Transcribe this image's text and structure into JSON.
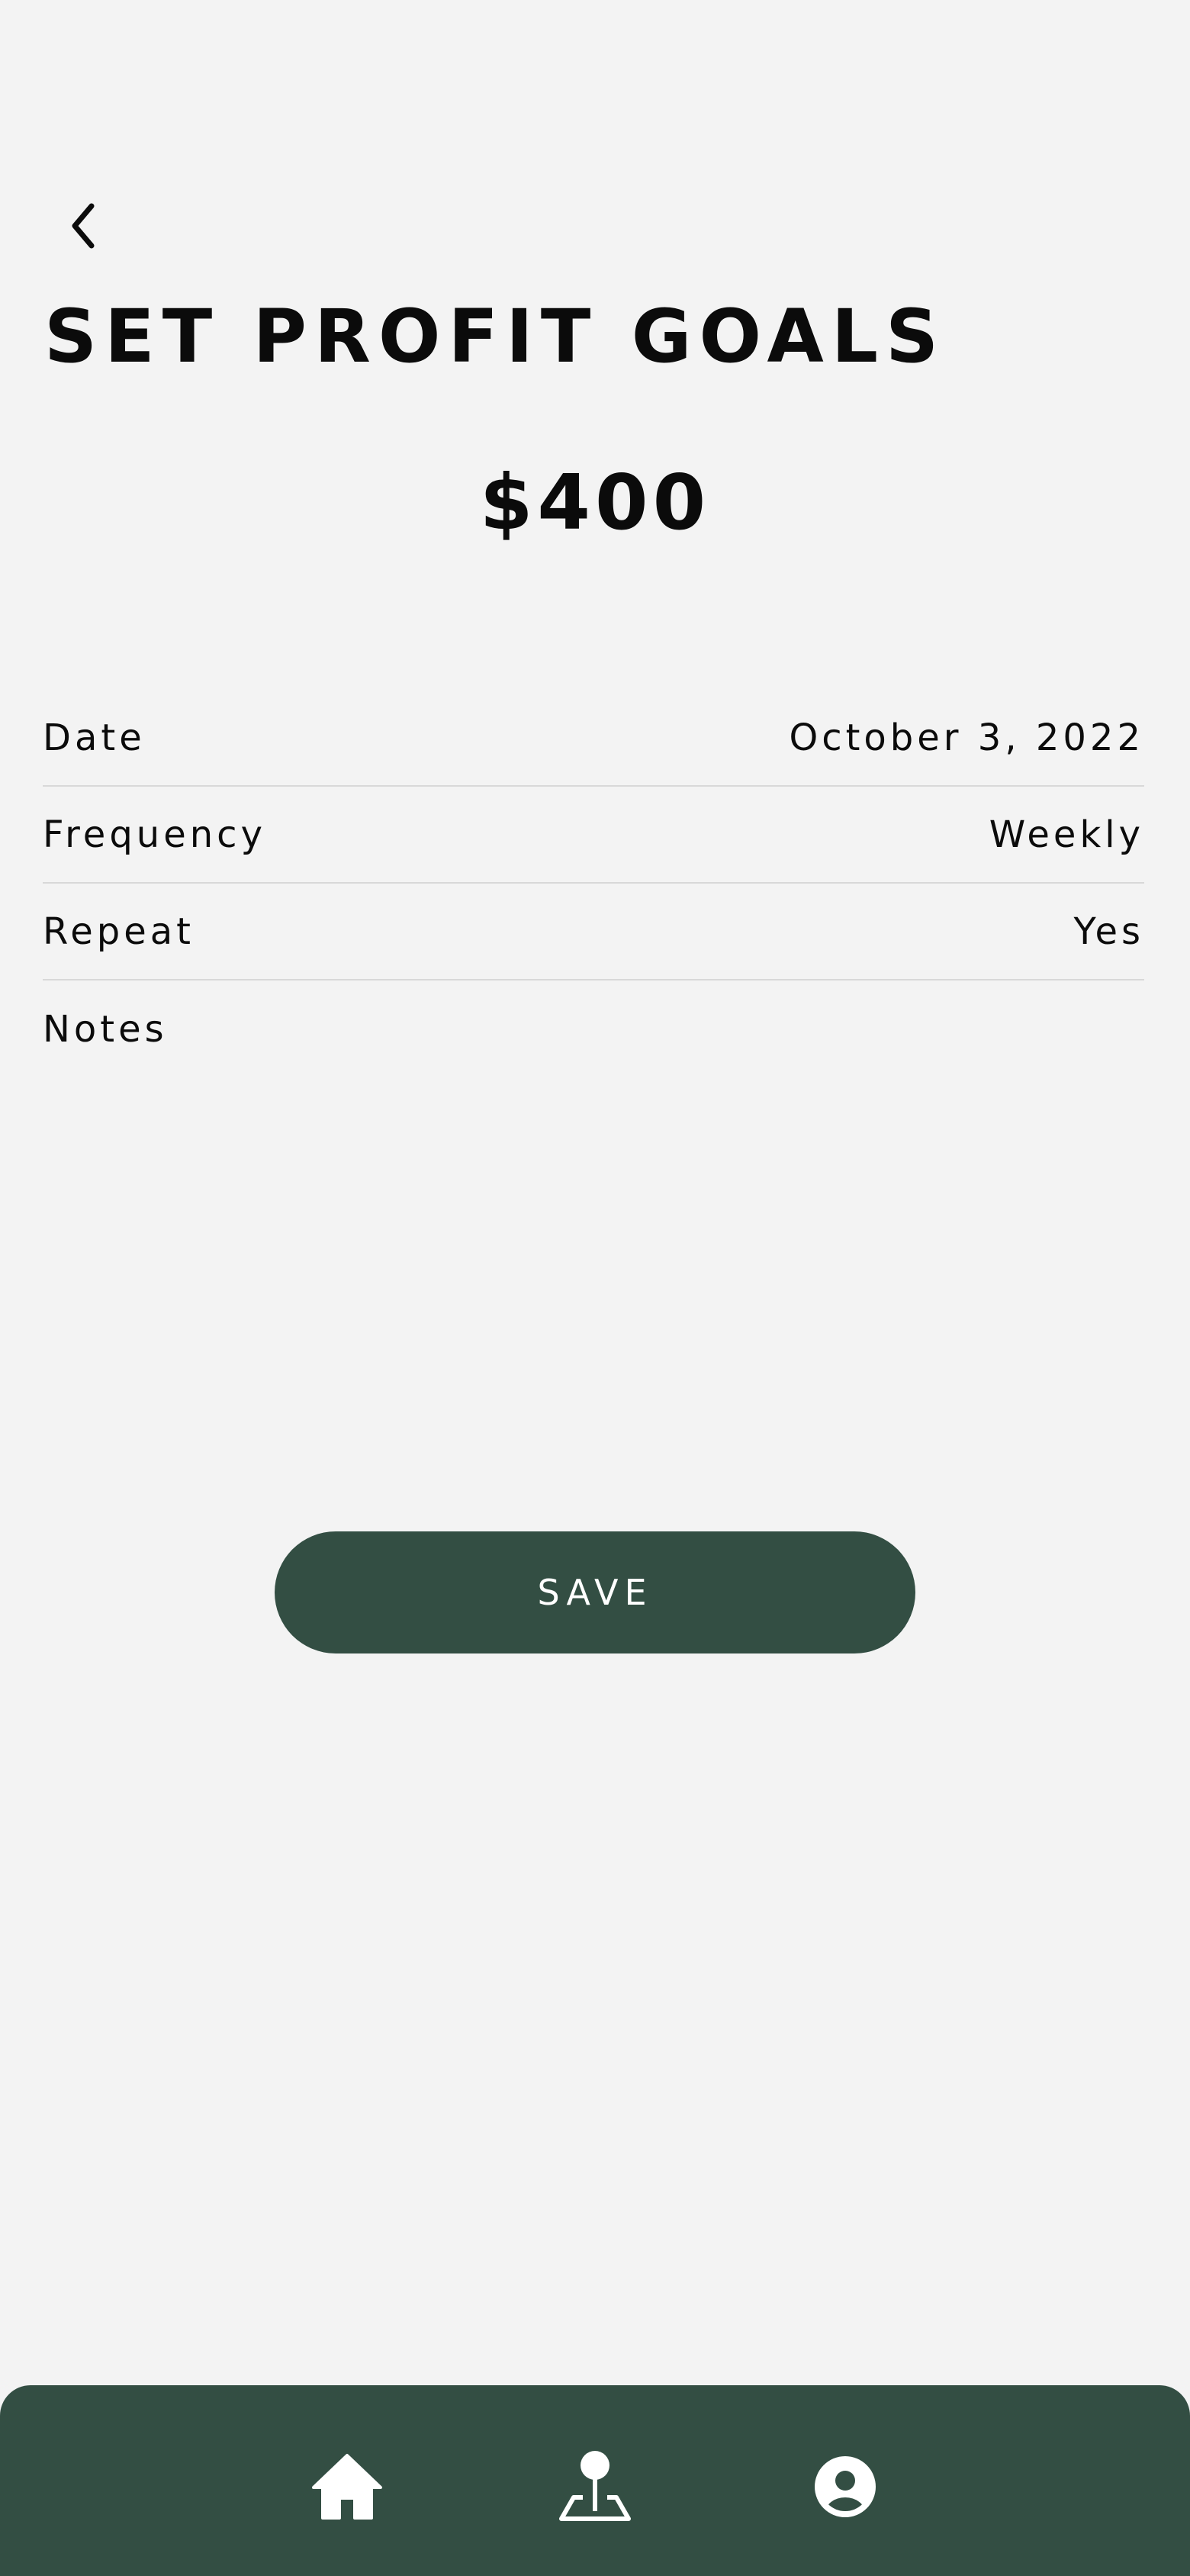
{
  "header": {
    "back_icon": "chevron-left-icon",
    "title": "SET PROFIT GOALS"
  },
  "goal": {
    "amount": "$400"
  },
  "details": [
    {
      "label": "Date",
      "value": "October 3, 2022"
    },
    {
      "label": "Frequency",
      "value": "Weekly"
    },
    {
      "label": "Repeat",
      "value": "Yes"
    },
    {
      "label": "Notes",
      "value": ""
    }
  ],
  "actions": {
    "save_label": "SAVE"
  },
  "bottom_nav": {
    "items": [
      {
        "name": "home",
        "icon": "home-icon"
      },
      {
        "name": "location",
        "icon": "map-pin-icon"
      },
      {
        "name": "profile",
        "icon": "user-circle-icon"
      }
    ]
  },
  "colors": {
    "background": "#f3f3f3",
    "accent": "#334e43",
    "text": "#0b0b0b",
    "divider": "#d8d8d8"
  }
}
